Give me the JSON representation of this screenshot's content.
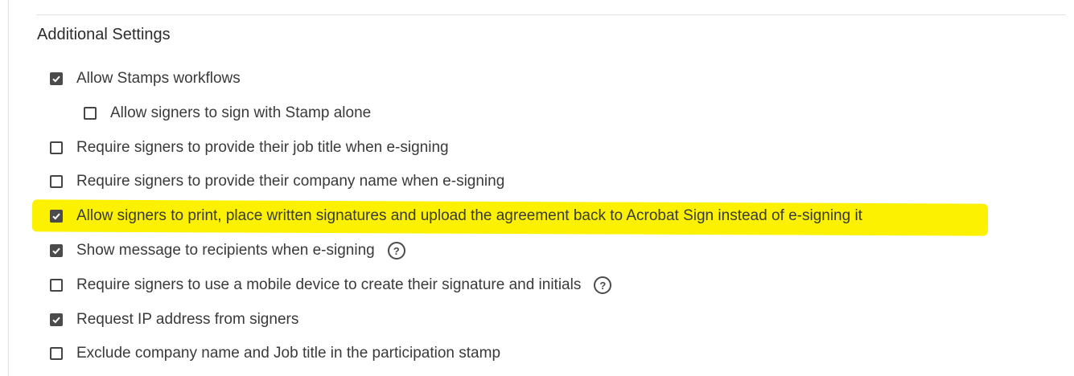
{
  "section": {
    "title": "Additional Settings"
  },
  "settings": [
    {
      "label": "Allow Stamps workflows",
      "checked": true,
      "help": false
    },
    {
      "label": "Allow signers to sign with Stamp alone",
      "checked": false,
      "help": false
    },
    {
      "label": "Require signers to provide their job title when e-signing",
      "checked": false,
      "help": false
    },
    {
      "label": "Require signers to provide their company name when e-signing",
      "checked": false,
      "help": false
    },
    {
      "label": "Allow signers to print, place written signatures and upload the agreement back to Acrobat Sign instead of e-signing it",
      "checked": true,
      "help": false,
      "highlighted": true
    },
    {
      "label": "Show message to recipients when e-signing",
      "checked": true,
      "help": true
    },
    {
      "label": "Require signers to use a mobile device to create their signature and initials",
      "checked": false,
      "help": true
    },
    {
      "label": "Request IP address from signers",
      "checked": true,
      "help": false
    },
    {
      "label": "Exclude company name and Job title in the participation stamp",
      "checked": false,
      "help": false
    }
  ],
  "help_icon_glyph": "?",
  "colors": {
    "highlight": "#fbf100",
    "checkbox": "#4b4b4b"
  }
}
